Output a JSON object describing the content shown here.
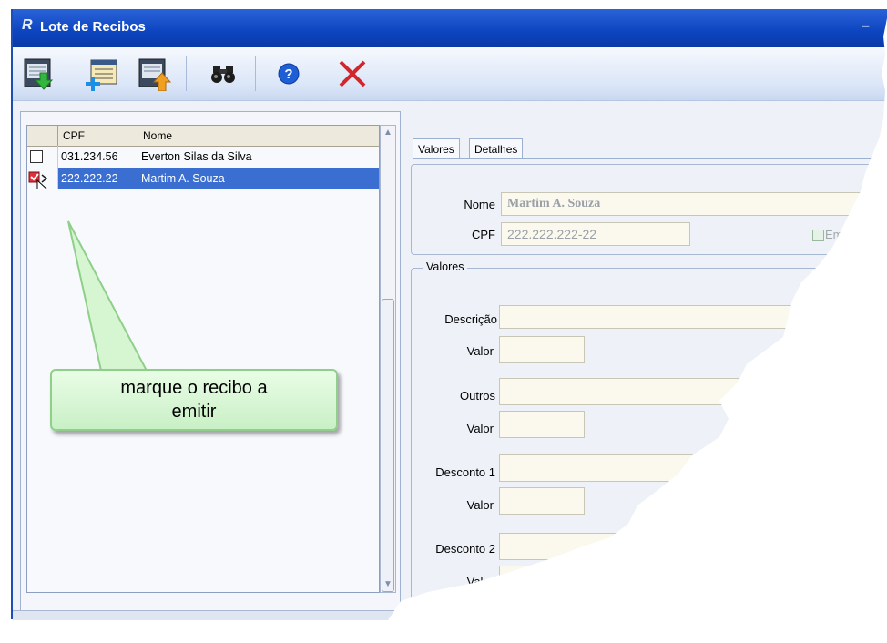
{
  "window": {
    "title": "Lote de Recibos"
  },
  "toolbar": {
    "buttons": [
      {
        "name": "export-down-button",
        "icon": "doc-arrow-down-icon"
      },
      {
        "name": "new-button",
        "icon": "doc-plus-icon"
      },
      {
        "name": "import-up-button",
        "icon": "doc-arrow-up-icon"
      },
      {
        "name": "search-button",
        "icon": "binoculars-icon"
      },
      {
        "name": "help-button",
        "icon": "help-icon"
      },
      {
        "name": "close-button",
        "icon": "close-icon"
      }
    ]
  },
  "grid": {
    "columns": [
      "CPF",
      "Nome"
    ],
    "rows": [
      {
        "cpf": "031.234.56",
        "nome": "Everton Silas da Silva",
        "selected": false
      },
      {
        "cpf": "222.222.22",
        "nome": "Martim A. Souza",
        "selected": true
      }
    ]
  },
  "callout": {
    "line1": "marque o recibo a",
    "line2": "emitir"
  },
  "tabs": [
    "Valores",
    "Detalhes"
  ],
  "form": {
    "nome_label": "Nome",
    "nome_value": "Martim A. Souza",
    "cpf_label": "CPF",
    "cpf_value": "222.222.222-22",
    "em_label": "Em",
    "valores_caption": "Valores",
    "descricao_label": "Descrição",
    "valor_label": "Valor",
    "outros_label": "Outros",
    "desconto1_label": "Desconto 1",
    "desconto2_label": "Desconto 2"
  },
  "colors": {
    "titlebar": "#0c44c0",
    "selection": "#3a6ed0",
    "field_bg": "#fbf9ee",
    "callout_bg": "#c9f0c6",
    "close_red": "#d2262b"
  }
}
